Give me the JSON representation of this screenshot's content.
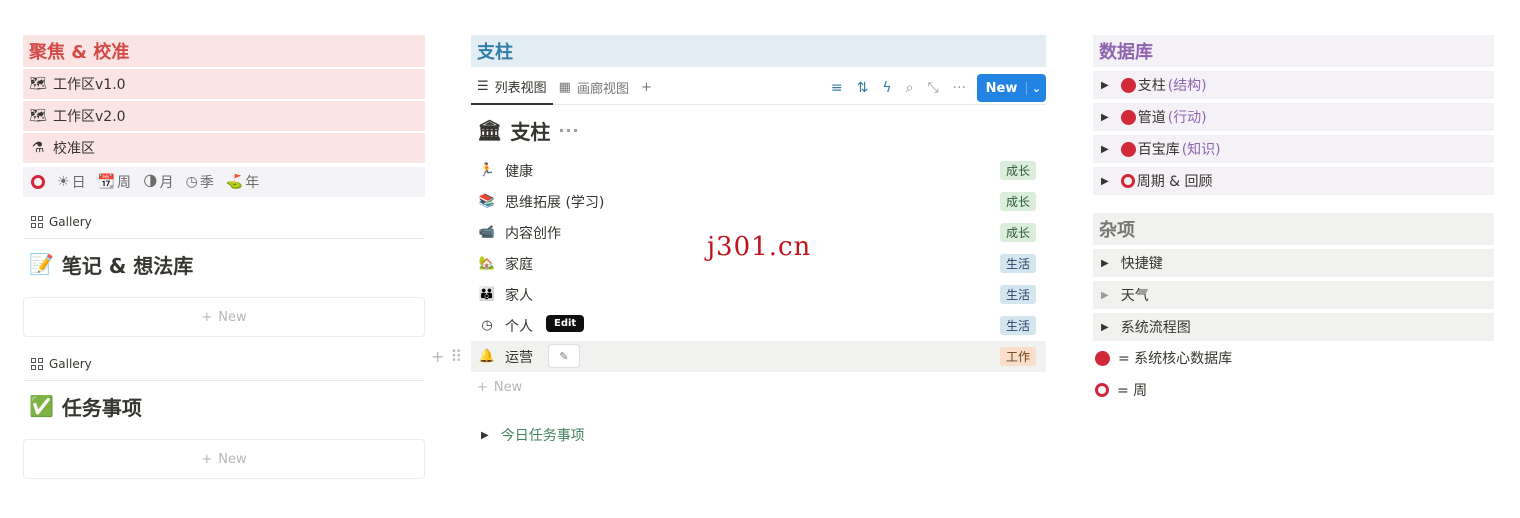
{
  "left": {
    "callout_title": "聚焦 & 校准",
    "links": [
      {
        "icon": "🗺",
        "label": "工作区v1.0"
      },
      {
        "icon": "🗺",
        "label": "工作区v2.0"
      },
      {
        "icon": "⚗",
        "label": "校准区"
      }
    ],
    "periods": [
      {
        "icon": "☀",
        "label": "日"
      },
      {
        "icon": "📆",
        "label": "周"
      },
      {
        "icon": "🌗",
        "label": "月"
      },
      {
        "icon": "◷",
        "label": "季"
      },
      {
        "icon": "⛳",
        "label": "年"
      }
    ],
    "sections": [
      {
        "tab": "Gallery",
        "icon": "📝",
        "title": "笔记 & 想法库",
        "new_label": "New"
      },
      {
        "tab": "Gallery",
        "icon": "✅",
        "title": "任务事项",
        "new_label": "New"
      }
    ]
  },
  "middle": {
    "callout_title": "支柱",
    "views": [
      {
        "icon": "☰",
        "label": "列表视图"
      },
      {
        "icon": "▦",
        "label": "画廊视图"
      }
    ],
    "add_view": "+",
    "new_button": "New",
    "db_icon": "🏛",
    "db_title": "支柱",
    "db_more": "···",
    "rows": [
      {
        "icon": "🏃",
        "label": "健康",
        "tag": "成长"
      },
      {
        "icon": "📚",
        "label": "思维拓展 (学习)",
        "tag": "成长"
      },
      {
        "icon": "📹",
        "label": "内容创作",
        "tag": "成长"
      },
      {
        "icon": "🏡",
        "label": "家庭",
        "tag": "生活"
      },
      {
        "icon": "👪",
        "label": "家人",
        "tag": "生活"
      },
      {
        "icon": "◷",
        "label": "个人",
        "tag": "生活"
      },
      {
        "icon": "🔔",
        "label": "运营",
        "tag": "工作"
      }
    ],
    "edit_tooltip": "Edit",
    "add_new_label": "New",
    "toggle_label": "今日任务事项"
  },
  "right": {
    "db_title": "数据库",
    "db_items": [
      {
        "label": "支柱",
        "sub": "(结构)",
        "marker": "dot"
      },
      {
        "label": "管道",
        "sub": "(行动)",
        "marker": "dot"
      },
      {
        "label": "百宝库",
        "sub": "(知识)",
        "marker": "dot"
      },
      {
        "label": "周期 & 回顾",
        "sub": "",
        "marker": "ring"
      }
    ],
    "misc_title": "杂项",
    "misc_items": [
      "快捷键",
      "天气",
      "系统流程图"
    ],
    "legend": [
      {
        "marker": "dot",
        "label": "= 系统核心数据库"
      },
      {
        "marker": "ring",
        "label": "= 周"
      }
    ]
  },
  "watermark": "j301.cn",
  "colors": {
    "accent": "#2383e2",
    "red_marker": "#d1283a",
    "red_callout": "#fbe4e4",
    "blue_callout": "#e2eef4"
  }
}
